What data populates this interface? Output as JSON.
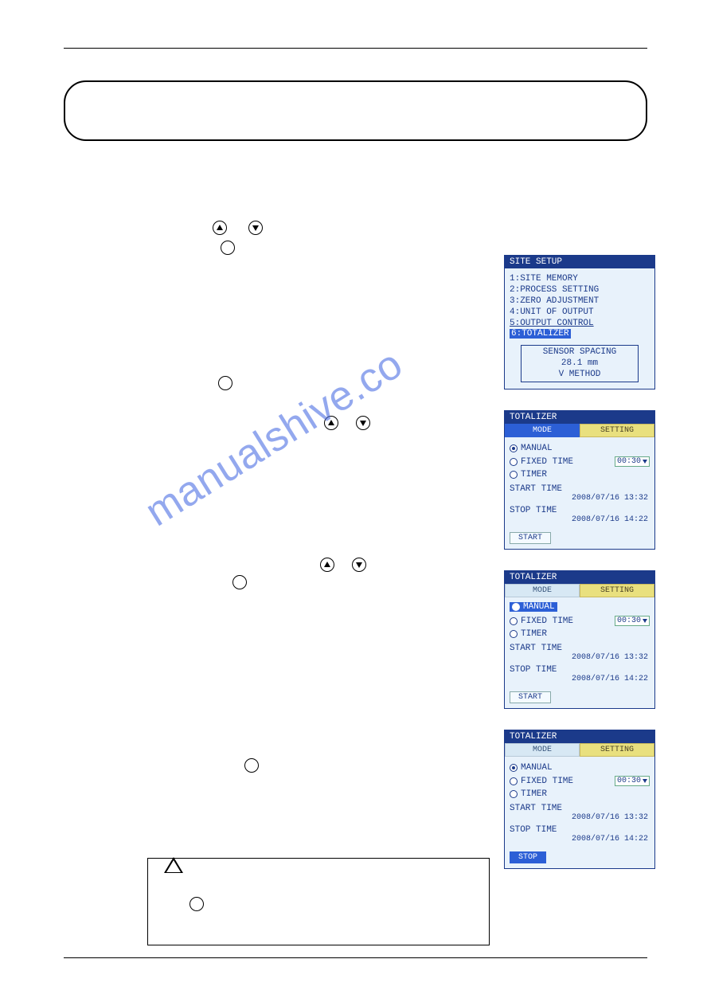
{
  "watermark": "manualshive.co",
  "screen1": {
    "title": "SITE SETUP",
    "items": [
      "1:SITE MEMORY",
      "2:PROCESS SETTING",
      "3:ZERO ADJUSTMENT",
      "4:UNIT OF OUTPUT",
      "5:OUTPUT CONTROL",
      "6:TOTALIZER"
    ],
    "sensor": {
      "l1": "SENSOR SPACING",
      "l2": "28.1 mm",
      "l3": "V METHOD"
    }
  },
  "screen2": {
    "title": "TOTALIZER"
  },
  "screen3": {
    "title": "TOTALIZER"
  },
  "screen4": {
    "title": "TOTALIZER"
  },
  "tabs": {
    "mode": "MODE",
    "setting": "SETTING"
  },
  "radios": {
    "manual": "MANUAL",
    "fixed": "FIXED TIME",
    "timer": "TIMER",
    "fixed_val": "00:30"
  },
  "times": {
    "start_label": "START TIME",
    "stop_label": "STOP TIME",
    "start_val": "2008/07/16 13:32",
    "stop_val": "2008/07/16 14:22"
  },
  "buttons": {
    "start": "START",
    "stop": "STOP"
  }
}
